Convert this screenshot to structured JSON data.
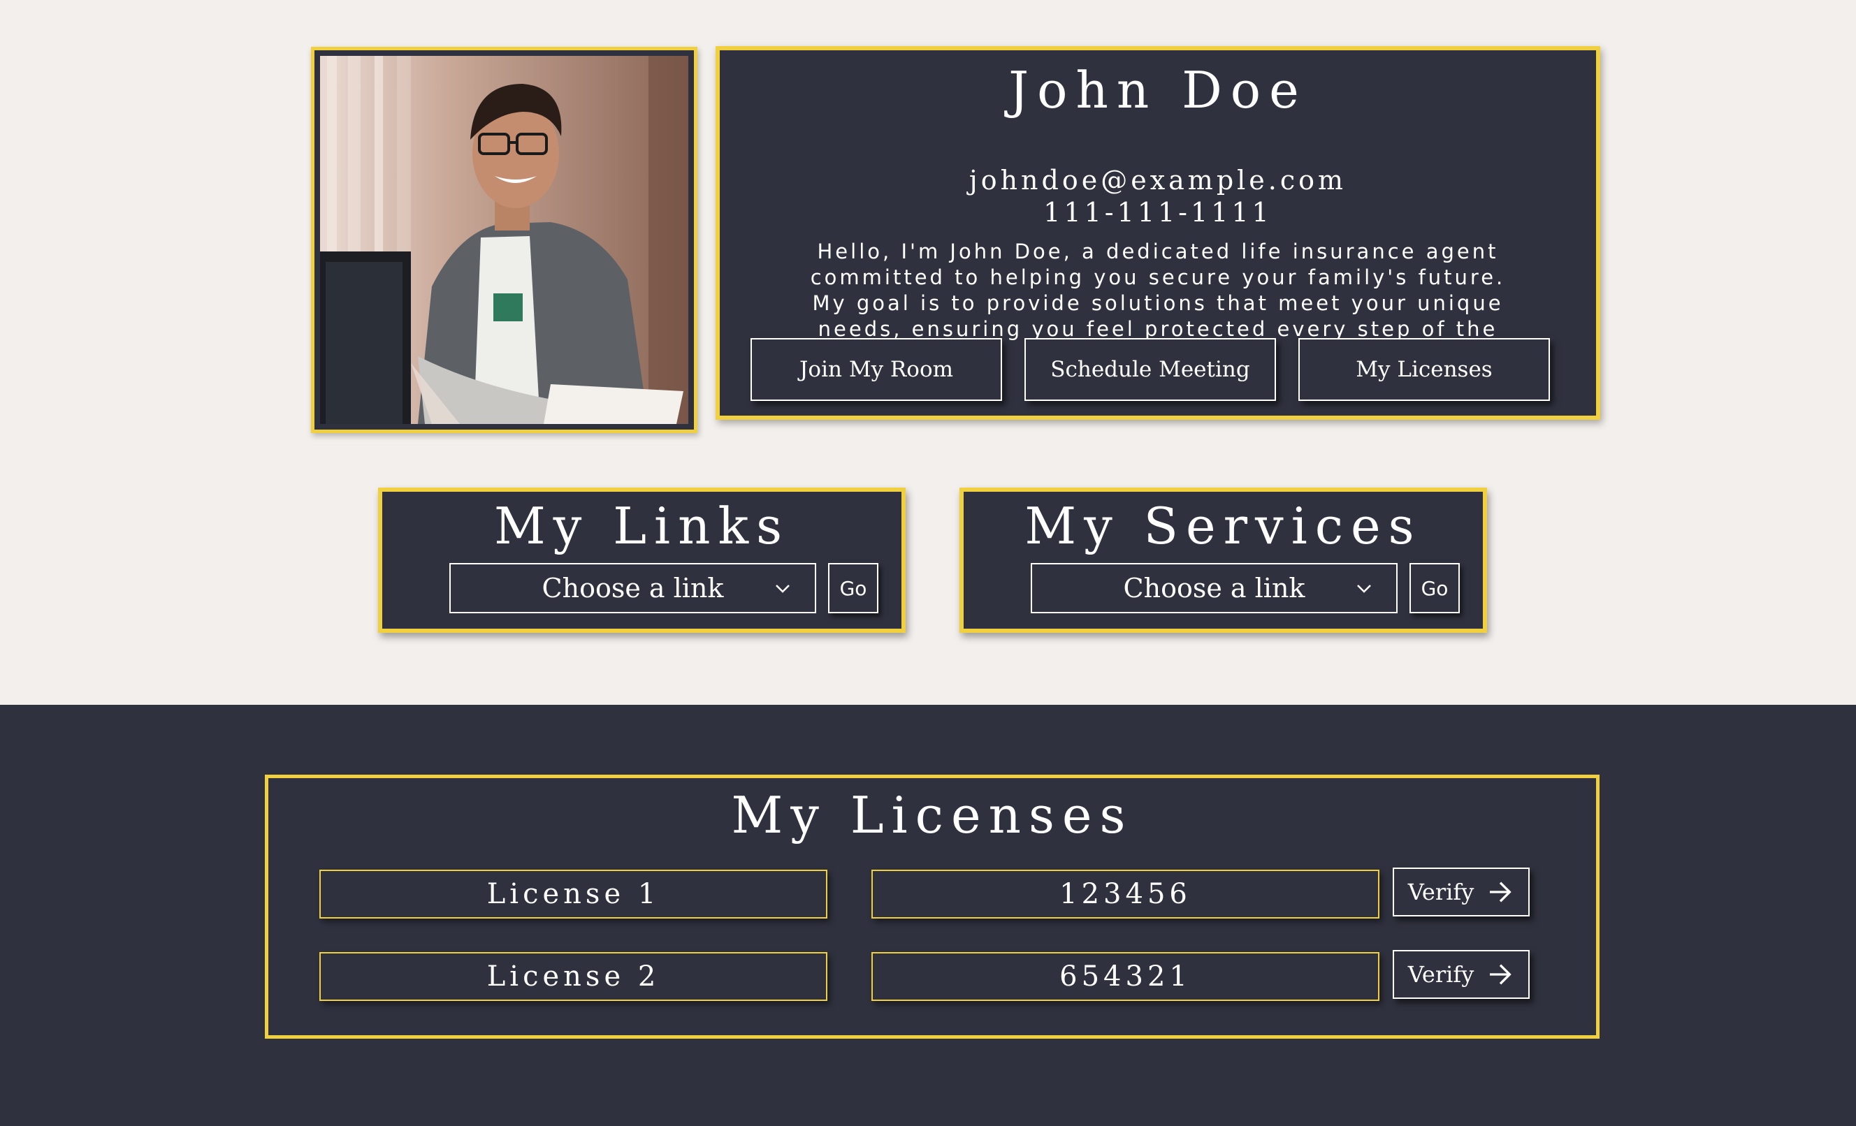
{
  "profile": {
    "name": "John Doe",
    "email": "johndoe@example.com",
    "phone": "111-111-1111",
    "bio": "Hello, I'm John Doe, a dedicated life insurance agent committed to helping you secure your family's future. My goal is to provide solutions that meet your unique needs, ensuring you feel protected every step of the way.",
    "photo_icon": "profile-photo"
  },
  "actions": {
    "join_room": "Join My Room",
    "schedule_meeting": "Schedule Meeting",
    "my_licenses": "My Licenses"
  },
  "links_card": {
    "title": "My Links",
    "select_value": "Choose a link",
    "go_label": "Go"
  },
  "services_card": {
    "title": "My Services",
    "select_value": "Choose a link",
    "go_label": "Go"
  },
  "licenses": {
    "title": "My Licenses",
    "rows": [
      {
        "name": "License 1",
        "number": "123456",
        "verify_label": "Verify"
      },
      {
        "name": "License 2",
        "number": "654321",
        "verify_label": "Verify"
      }
    ]
  },
  "colors": {
    "page_background": "#f3efec",
    "card_navy": "#2f313e",
    "accent_gold": "#f0d03e",
    "text": "#ffffff"
  }
}
